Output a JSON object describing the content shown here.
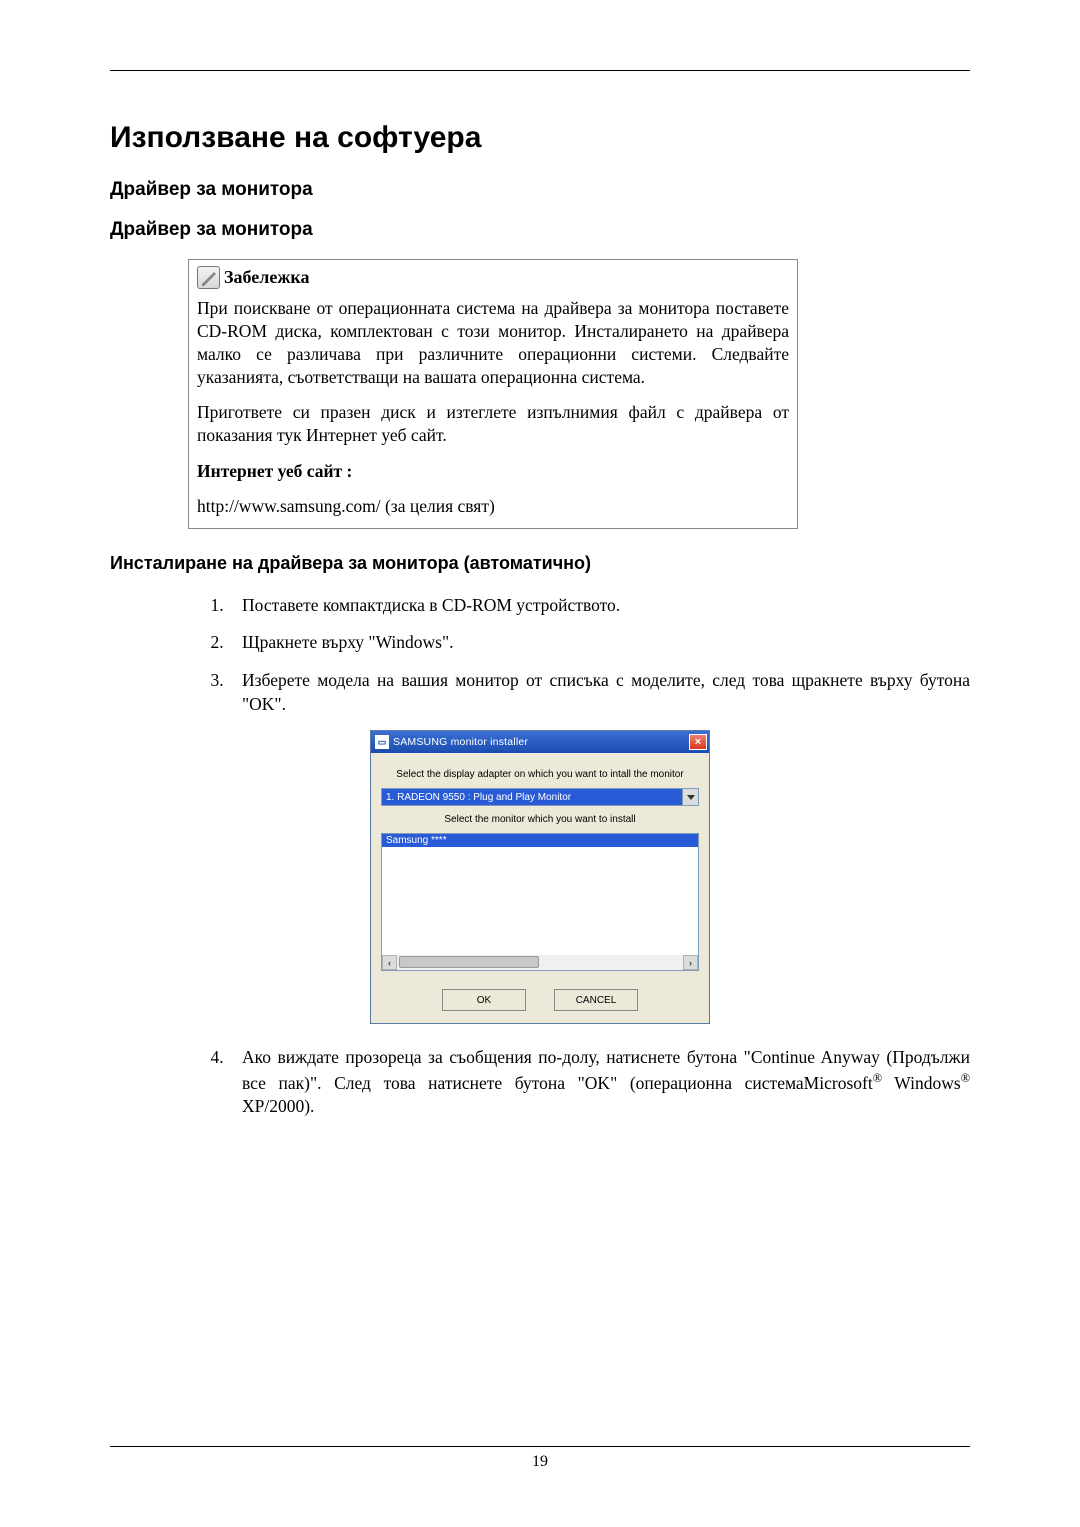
{
  "page": {
    "title": "Използване на софтуера",
    "h2a": "Драйвер за монитора",
    "h2b": "Драйвер за монитора",
    "note": {
      "title": "Забележка",
      "p1": "При поискване от операционната система на драйвера за монитора поставете CD-ROM диска, комплектован с този монитор. Инсталирането на драйвера малко се различава при различните операционни системи. Следвайте указанията, съответстващи на вашата операционна система.",
      "p2": "Пригответе си празен диск и изтеглете изпълнимия файл с драйвера от показания тук Интернет уеб сайт.",
      "p3_label": "Интернет уеб сайт :",
      "url": "http://www.samsung.com/ (за целия свят)"
    },
    "h3": "Инсталиране на драйвера за монитора (автоматично)",
    "steps": {
      "s1": "Поставете компактдиска в CD-ROM устройството.",
      "s2": "Щракнете върху \"Windows\".",
      "s3": "Изберете модела на вашия монитор от списъка с моделите, след това щракнете върху бутона \"OK\".",
      "s4": "Ако виждате прозореца за съобщения по-долу, натиснете бутона \"Continue Anyway (Продължи все пак)\". След това натиснете бутона \"OK\" (операционна системаMicrosoft® Windows® XP/2000)."
    },
    "installer": {
      "title": "SAMSUNG monitor installer",
      "label1": "Select the display adapter on which you want to intall the monitor",
      "adapter": "1. RADEON 9550 : Plug and Play Monitor",
      "label2": "Select the monitor which you want to install",
      "monitor": "Samsung ****",
      "ok": "OK",
      "cancel": "CANCEL"
    },
    "page_no": "19"
  }
}
